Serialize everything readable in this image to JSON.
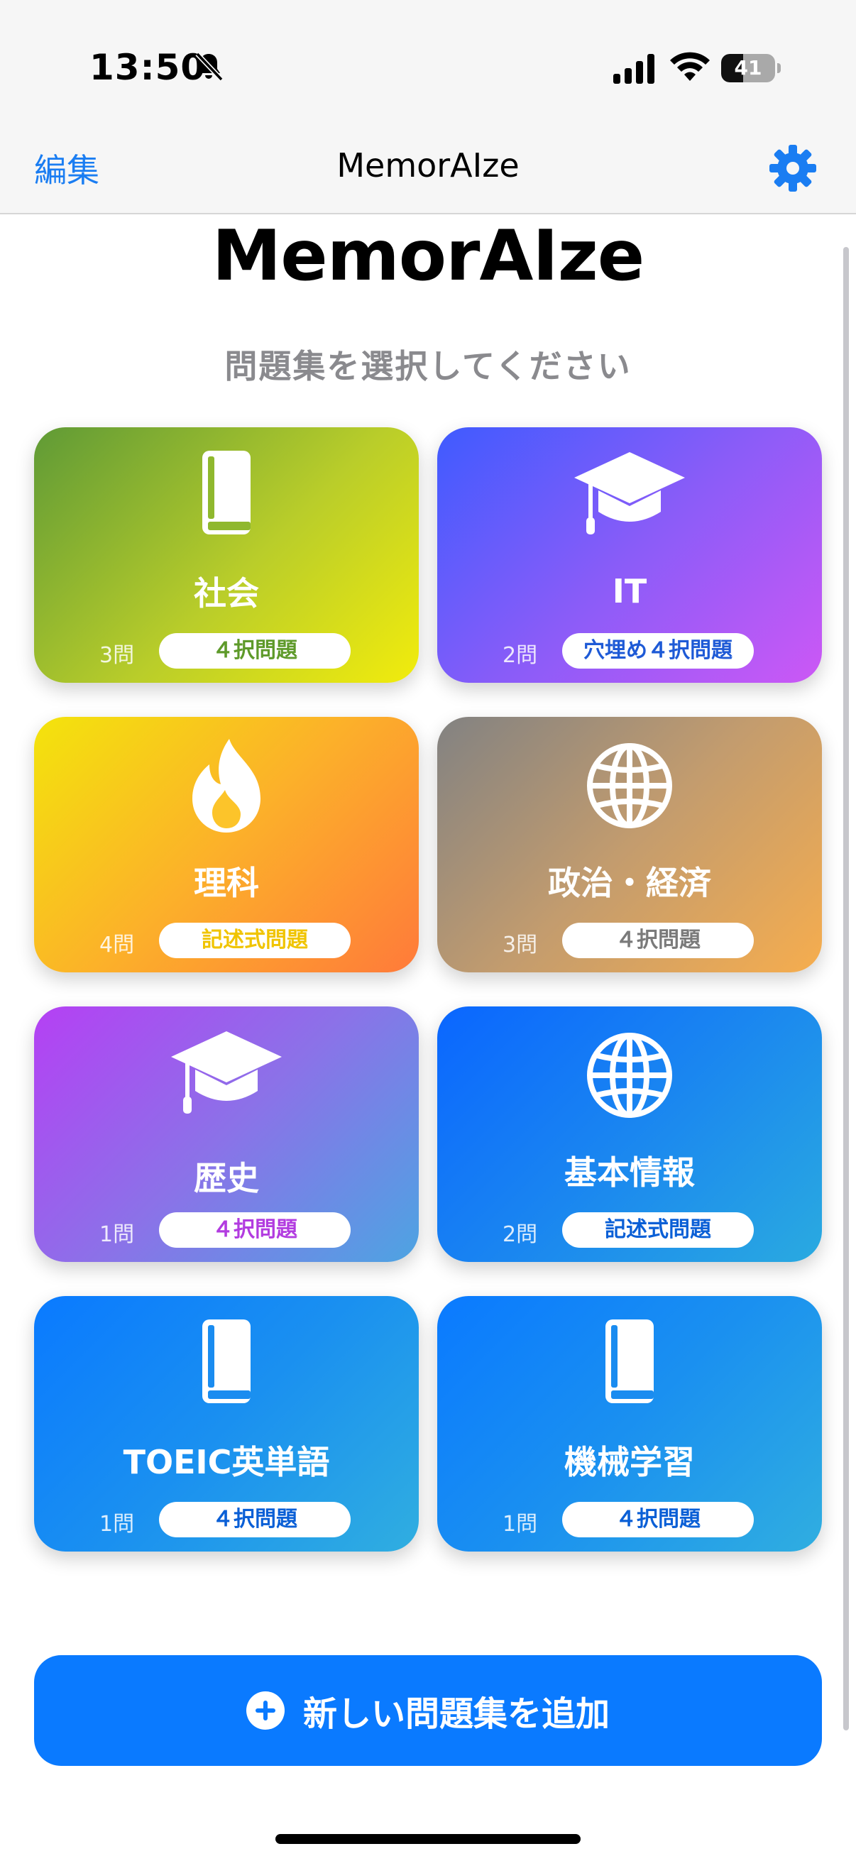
{
  "status_bar": {
    "time": "13:50",
    "battery": "41",
    "battery_level": 0.41
  },
  "nav": {
    "edit_label": "編集",
    "title": "MemorAIze",
    "settings_icon": "gear-icon"
  },
  "main": {
    "app_title": "MemorAIze",
    "subtitle": "問題集を選択してください"
  },
  "cards": [
    {
      "title": "社会",
      "count": "3問",
      "badge": "４択問題",
      "icon": "book-icon",
      "badge_color": "#5e9a2a"
    },
    {
      "title": "IT",
      "count": "2問",
      "badge": "穴埋め４択問題",
      "icon": "graduation-cap-icon",
      "badge_color": "#1e5ad6"
    },
    {
      "title": "理科",
      "count": "4問",
      "badge": "記述式問題",
      "icon": "flame-icon",
      "badge_color": "#f0c400"
    },
    {
      "title": "政治・経済",
      "count": "3問",
      "badge": "４択問題",
      "icon": "globe-icon",
      "badge_color": "#7a7a7a"
    },
    {
      "title": "歴史",
      "count": "1問",
      "badge": "４択問題",
      "icon": "graduation-cap-icon",
      "badge_color": "#b23ce0"
    },
    {
      "title": "基本情報",
      "count": "2問",
      "badge": "記述式問題",
      "icon": "globe-icon",
      "badge_color": "#0a5fd6"
    },
    {
      "title": "TOEIC英単語",
      "count": "1問",
      "badge": "４択問題",
      "icon": "book-icon",
      "badge_color": "#0a5fd6"
    },
    {
      "title": "機械学習",
      "count": "1問",
      "badge": "４択問題",
      "icon": "book-icon",
      "badge_color": "#0a5fd6"
    }
  ],
  "add_button": {
    "label": "新しい問題集を追加",
    "icon": "plus-circle-icon"
  }
}
